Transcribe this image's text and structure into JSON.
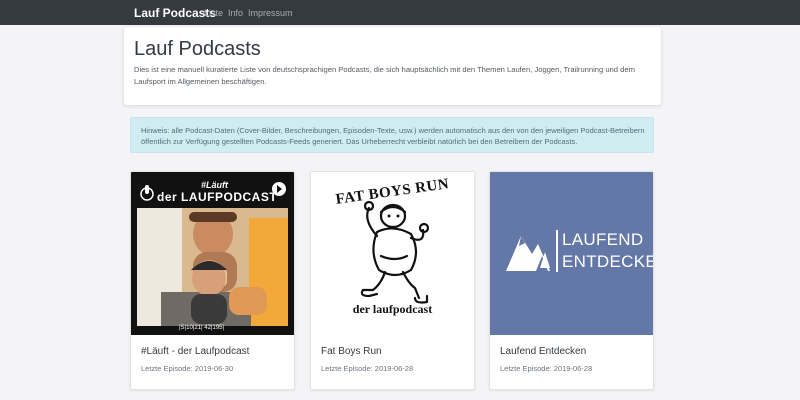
{
  "nav": {
    "brand": "Lauf Podcasts",
    "links": [
      "Liste",
      "Info",
      "Impressum"
    ]
  },
  "header": {
    "title": "Lauf Podcasts",
    "description": "Dies ist eine manuell kuratierte Liste von deutschsprachigen Podcasts, die sich hauptsächlich mit den Themen Laufen, Joggen, Trailrunning und dem Laufsport im Allgemeinen beschäftigen."
  },
  "notice": {
    "text": "Hinweis: alle Podcast-Daten (Cover-Bilder, Beschreibungen, Episoden-Texte, usw.) werden automatisch aus den von den jeweiligen Podcast-Betreibern öffentlich zur Verfügung gestellten Podcasts-Feeds generiert. Das Urheberrecht verbleibt natürlich bei den Betreibern der Podcasts."
  },
  "podcasts": [
    {
      "title": "#Läuft - der Laufpodcast",
      "last_episode": "Letzte Episode: 2019-06-30",
      "cover_text": {
        "hashtag": "#Läuft",
        "name": "der LAUFPODCAST",
        "footer": "|S|10|21| 42|195|"
      }
    },
    {
      "title": "Fat Boys Run",
      "last_episode": "Letzte Episode: 2019-06-28",
      "cover_text": {
        "headline": "FAT BOYS RUN",
        "subline": "der laufpodcast"
      }
    },
    {
      "title": "Laufend Entdecken",
      "last_episode": "Letzte Episode: 2019-06-28",
      "cover_text": {
        "line1": "LAUFEND",
        "line2": "ENTDECKEN"
      }
    }
  ],
  "colors": {
    "navbar": "#343a40",
    "background": "#f4f4f6",
    "alert_bg": "#d1ecf1",
    "cover3_bg": "#6478a8"
  }
}
